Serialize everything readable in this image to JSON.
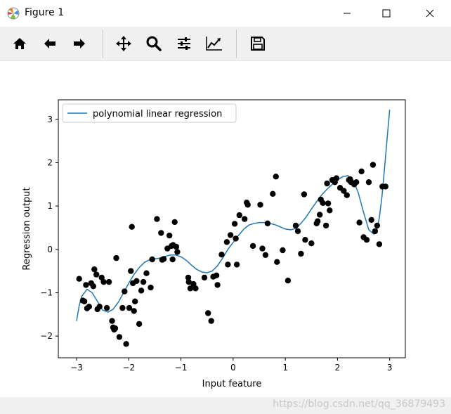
{
  "window": {
    "title": "Figure 1",
    "icon": "matplotlib-icon"
  },
  "toolbar": {
    "buttons": [
      {
        "name": "home-icon",
        "tooltip": "Reset original view"
      },
      {
        "name": "back-icon",
        "tooltip": "Back to previous view"
      },
      {
        "name": "forward-icon",
        "tooltip": "Forward to next view"
      },
      {
        "name": "pan-icon",
        "tooltip": "Pan axes"
      },
      {
        "name": "zoom-icon",
        "tooltip": "Zoom to rectangle"
      },
      {
        "name": "subplots-icon",
        "tooltip": "Configure subplots"
      },
      {
        "name": "axes-edit-icon",
        "tooltip": "Edit axis"
      },
      {
        "name": "save-icon",
        "tooltip": "Save the figure"
      }
    ]
  },
  "status": {
    "watermark": "https://blog.csdn.net/qq_36879493"
  },
  "colors": {
    "line": "#1f77b4",
    "points": "#000000"
  },
  "chart_data": {
    "type": "scatter",
    "title": "",
    "xlabel": "Input feature",
    "ylabel": "Regression output",
    "xlim": [
      -3.35,
      3.3
    ],
    "ylim": [
      -2.5,
      3.45
    ],
    "xticks": [
      -3,
      -2,
      -1,
      0,
      1,
      2,
      3
    ],
    "yticks": [
      -2,
      -1,
      0,
      1,
      2,
      3
    ],
    "xtick_labels": [
      "−3",
      "−2",
      "−1",
      "0",
      "1",
      "2",
      "3"
    ],
    "ytick_labels": [
      "−2",
      "−1",
      "0",
      "1",
      "2",
      "3"
    ],
    "grid": false,
    "legend": {
      "location": "upper-left",
      "entries": [
        "polynomial linear regression"
      ]
    },
    "series": [
      {
        "name": "polynomial linear regression",
        "kind": "line",
        "color": "#1f77b4",
        "x": [
          -3.0,
          -2.95,
          -2.9,
          -2.8,
          -2.7,
          -2.6,
          -2.5,
          -2.4,
          -2.3,
          -2.2,
          -2.1,
          -2.0,
          -1.9,
          -1.8,
          -1.7,
          -1.6,
          -1.5,
          -1.4,
          -1.3,
          -1.2,
          -1.1,
          -1.0,
          -0.9,
          -0.8,
          -0.7,
          -0.6,
          -0.5,
          -0.4,
          -0.3,
          -0.2,
          -0.1,
          0.0,
          0.1,
          0.2,
          0.3,
          0.4,
          0.5,
          0.6,
          0.7,
          0.8,
          0.9,
          1.0,
          1.1,
          1.2,
          1.3,
          1.4,
          1.5,
          1.6,
          1.7,
          1.8,
          1.9,
          2.0,
          2.1,
          2.2,
          2.3,
          2.4,
          2.5,
          2.6,
          2.7,
          2.75,
          2.8,
          2.85,
          2.9,
          2.95,
          3.0
        ],
        "y": [
          -1.65,
          -1.3,
          -1.08,
          -0.92,
          -1.0,
          -1.2,
          -1.4,
          -1.45,
          -1.38,
          -1.22,
          -1.0,
          -0.78,
          -0.58,
          -0.42,
          -0.3,
          -0.24,
          -0.22,
          -0.2,
          -0.16,
          -0.13,
          -0.13,
          -0.17,
          -0.25,
          -0.36,
          -0.46,
          -0.52,
          -0.54,
          -0.5,
          -0.38,
          -0.2,
          0.0,
          0.16,
          0.32,
          0.46,
          0.56,
          0.6,
          0.62,
          0.62,
          0.6,
          0.57,
          0.52,
          0.47,
          0.45,
          0.48,
          0.6,
          0.75,
          0.93,
          1.1,
          1.26,
          1.39,
          1.5,
          1.6,
          1.68,
          1.7,
          1.6,
          1.3,
          0.85,
          0.45,
          0.35,
          0.42,
          0.72,
          1.2,
          1.85,
          2.55,
          3.22
        ]
      },
      {
        "name": "",
        "kind": "scatter",
        "color": "#000000",
        "x": [
          -2.95,
          -2.88,
          -2.85,
          -2.82,
          -2.8,
          -2.76,
          -2.72,
          -2.68,
          -2.66,
          -2.62,
          -2.6,
          -2.56,
          -2.52,
          -2.48,
          -2.42,
          -2.38,
          -2.32,
          -2.3,
          -2.28,
          -2.26,
          -2.24,
          -2.18,
          -2.12,
          -2.08,
          -2.05,
          -1.99,
          -1.96,
          -1.94,
          -1.92,
          -1.9,
          -1.88,
          -1.85,
          -1.8,
          -1.76,
          -1.72,
          -1.66,
          -1.58,
          -1.55,
          -1.46,
          -1.38,
          -1.36,
          -1.33,
          -1.26,
          -1.22,
          -1.18,
          -1.16,
          -1.15,
          -1.12,
          -1.09,
          -1.07,
          -0.86,
          -0.85,
          -0.82,
          -0.76,
          -0.72,
          -0.55,
          -0.48,
          -0.42,
          -0.38,
          -0.32,
          -0.3,
          -0.22,
          -0.12,
          -0.1,
          -0.05,
          0.03,
          0.05,
          0.07,
          0.12,
          0.22,
          0.26,
          0.28,
          0.38,
          0.52,
          0.56,
          0.62,
          0.66,
          0.76,
          0.82,
          0.84,
          0.95,
          1.05,
          1.2,
          1.24,
          1.3,
          1.36,
          1.38,
          1.5,
          1.6,
          1.62,
          1.66,
          1.68,
          1.72,
          1.78,
          1.8,
          1.82,
          1.85,
          1.9,
          1.95,
          1.98,
          2.05,
          2.12,
          2.18,
          2.22,
          2.24,
          2.26,
          2.32,
          2.36,
          2.42,
          2.46,
          2.5,
          2.56,
          2.6,
          2.65,
          2.68,
          2.72,
          2.76,
          2.8,
          2.86,
          2.92
        ],
        "y": [
          -0.68,
          -1.18,
          -1.2,
          -0.82,
          -1.36,
          -1.32,
          -0.78,
          -0.85,
          -0.46,
          -0.58,
          -1.38,
          -1.32,
          -0.65,
          -0.75,
          -1.35,
          -0.75,
          -1.65,
          -1.8,
          -1.85,
          -1.82,
          -0.2,
          -2.02,
          -1.35,
          -0.97,
          -2.18,
          -1.35,
          -0.5,
          0.52,
          -0.78,
          -1.42,
          -1.2,
          -0.73,
          -1.72,
          -0.95,
          -0.75,
          -0.55,
          -0.88,
          -0.23,
          0.7,
          0.38,
          -0.24,
          -0.22,
          0.02,
          0.32,
          0.08,
          -0.23,
          0.1,
          0.63,
          0.06,
          -0.06,
          -0.65,
          -0.75,
          -0.9,
          -0.8,
          -0.9,
          -0.65,
          -1.47,
          -1.65,
          -0.63,
          -0.6,
          -0.82,
          -0.12,
          0.17,
          -0.35,
          0.33,
          0.59,
          0.25,
          -0.35,
          0.79,
          0.7,
          1.08,
          1.03,
          0.08,
          1.03,
          0.02,
          -0.13,
          0.6,
          1.28,
          1.68,
          -0.29,
          -0.02,
          -0.72,
          0.55,
          0.42,
          -0.1,
          1.27,
          0.22,
          0.14,
          0.6,
          0.65,
          0.8,
          1.15,
          1.07,
          0.55,
          1.52,
          1.06,
          0.9,
          1.6,
          1.55,
          1.64,
          1.42,
          1.35,
          1.25,
          1.6,
          1.62,
          1.55,
          1.5,
          1.55,
          0.62,
          1.8,
          0.28,
          0.22,
          1.55,
          0.68,
          1.95,
          0.42,
          0.55,
          0.12,
          1.45,
          1.45
        ]
      }
    ]
  }
}
